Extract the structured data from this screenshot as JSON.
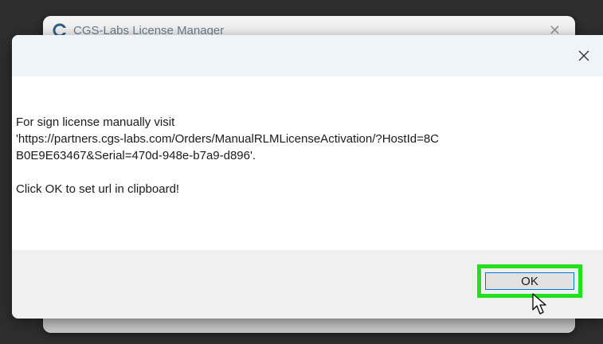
{
  "background_window": {
    "title": "CGS-Labs License Manager",
    "close_glyph": "✕",
    "logo_icon": "cgs-logo-icon"
  },
  "dialog": {
    "close_icon": "close-icon",
    "message_lines": [
      "For sign license manually visit",
      "'https://partners.cgs-labs.com/Orders/ManualRLMLicenseActivation/?HostId=8C",
      "B0E9E63467&Serial=470d-948e-b7a9-d896'."
    ],
    "instruction": "Click OK to set url in clipboard!",
    "ok_label": "OK"
  },
  "colors": {
    "highlight": "#22e11c",
    "button_border": "#0078d4",
    "titlebar": "#eff4f9",
    "footer": "#f0f0f0"
  },
  "pointer": "arrow-cursor-icon"
}
